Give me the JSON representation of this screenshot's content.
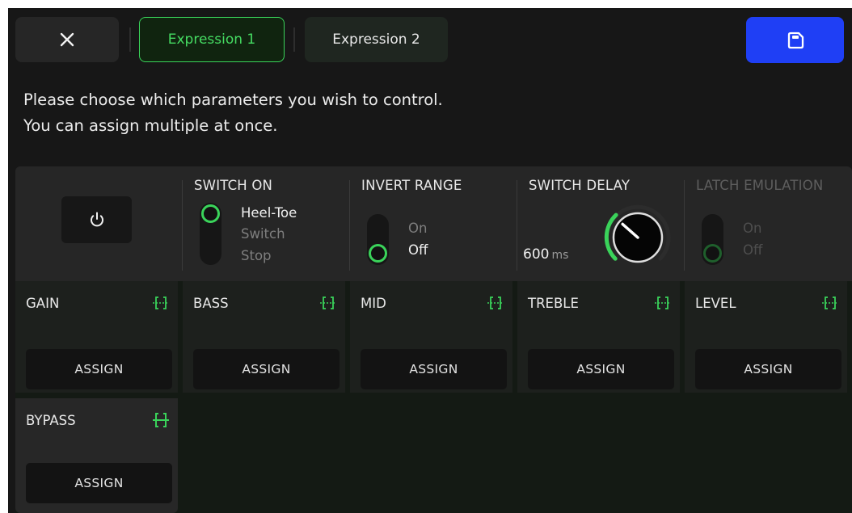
{
  "toolbar": {
    "close_icon": "close-icon",
    "tabs": [
      {
        "label": "Expression 1",
        "active": true
      },
      {
        "label": "Expression 2",
        "active": false
      }
    ],
    "save_icon": "save-icon",
    "save_color": "#1f3ff5"
  },
  "intro": {
    "line1": "Please choose which parameters you wish to control.",
    "line2": "You can assign multiple at once."
  },
  "settings": {
    "power_icon": "power-icon",
    "switch_on": {
      "title": "SWITCH ON",
      "options": [
        "Heel-Toe",
        "Switch",
        "Stop"
      ],
      "selected": "Heel-Toe"
    },
    "invert_range": {
      "title": "INVERT RANGE",
      "options": [
        "On",
        "Off"
      ],
      "selected": "Off"
    },
    "switch_delay": {
      "title": "SWITCH DELAY",
      "value": "600",
      "unit": "ms"
    },
    "latch_emulation": {
      "title": "LATCH EMULATION",
      "options": [
        "On",
        "Off"
      ],
      "selected": "Off",
      "disabled": true
    }
  },
  "params": [
    {
      "name": "GAIN",
      "button": "ASSIGN"
    },
    {
      "name": "BASS",
      "button": "ASSIGN"
    },
    {
      "name": "MID",
      "button": "ASSIGN"
    },
    {
      "name": "TREBLE",
      "button": "ASSIGN"
    },
    {
      "name": "LEVEL",
      "button": "ASSIGN"
    },
    {
      "name": "BYPASS",
      "button": "ASSIGN"
    }
  ],
  "accent_color": "#3ad35a"
}
